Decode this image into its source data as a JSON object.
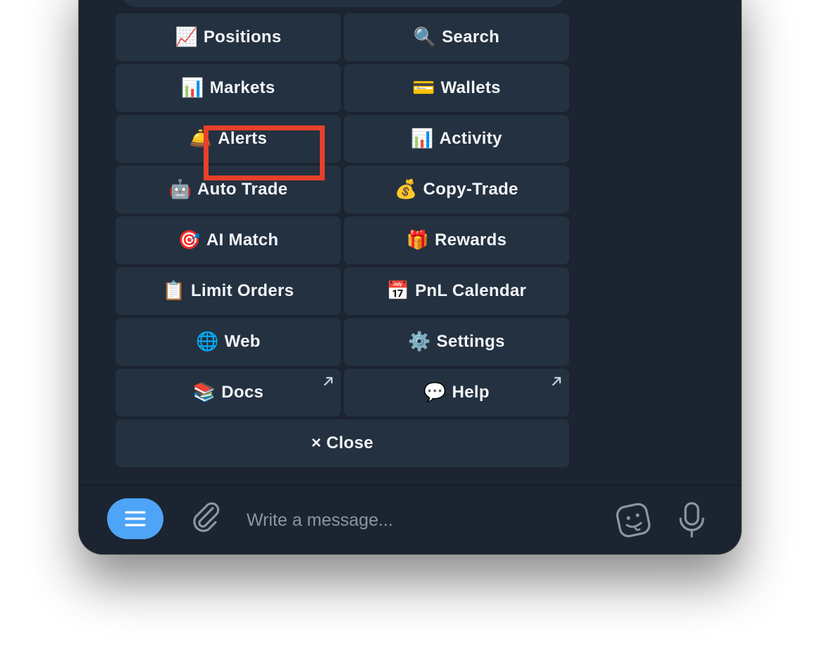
{
  "keyboard": {
    "buttons": [
      {
        "emoji": "📈",
        "label": "Positions",
        "external": false
      },
      {
        "emoji": "🔍",
        "label": "Search",
        "external": false
      },
      {
        "emoji": "📊",
        "label": "Markets",
        "external": false
      },
      {
        "emoji": "💳",
        "label": "Wallets",
        "external": false
      },
      {
        "emoji": "🛎️",
        "label": "Alerts",
        "external": false
      },
      {
        "emoji": "📊",
        "label": "Activity",
        "external": false
      },
      {
        "emoji": "🤖",
        "label": "Auto Trade",
        "external": false
      },
      {
        "emoji": "💰",
        "label": "Copy-Trade",
        "external": false
      },
      {
        "emoji": "🎯",
        "label": "AI Match",
        "external": false
      },
      {
        "emoji": "🎁",
        "label": "Rewards",
        "external": false
      },
      {
        "emoji": "📋",
        "label": "Limit Orders",
        "external": false
      },
      {
        "emoji": "📅",
        "label": "PnL Calendar",
        "external": false
      },
      {
        "emoji": "🌐",
        "label": "Web",
        "external": false
      },
      {
        "emoji": "⚙️",
        "label": "Settings",
        "external": false
      },
      {
        "emoji": "📚",
        "label": "Docs",
        "external": true
      },
      {
        "emoji": "💬",
        "label": "Help",
        "external": true
      }
    ],
    "close_label": "× Close"
  },
  "composer": {
    "placeholder": "Write a message...",
    "icons": {
      "menu": "menu-icon",
      "attach": "paperclip-icon",
      "sticker": "sticker-icon",
      "mic": "microphone-icon"
    }
  },
  "colors": {
    "background": "#1b2430",
    "button": "#243140",
    "accent": "#4ea4f6",
    "highlight": "#e8402a"
  }
}
